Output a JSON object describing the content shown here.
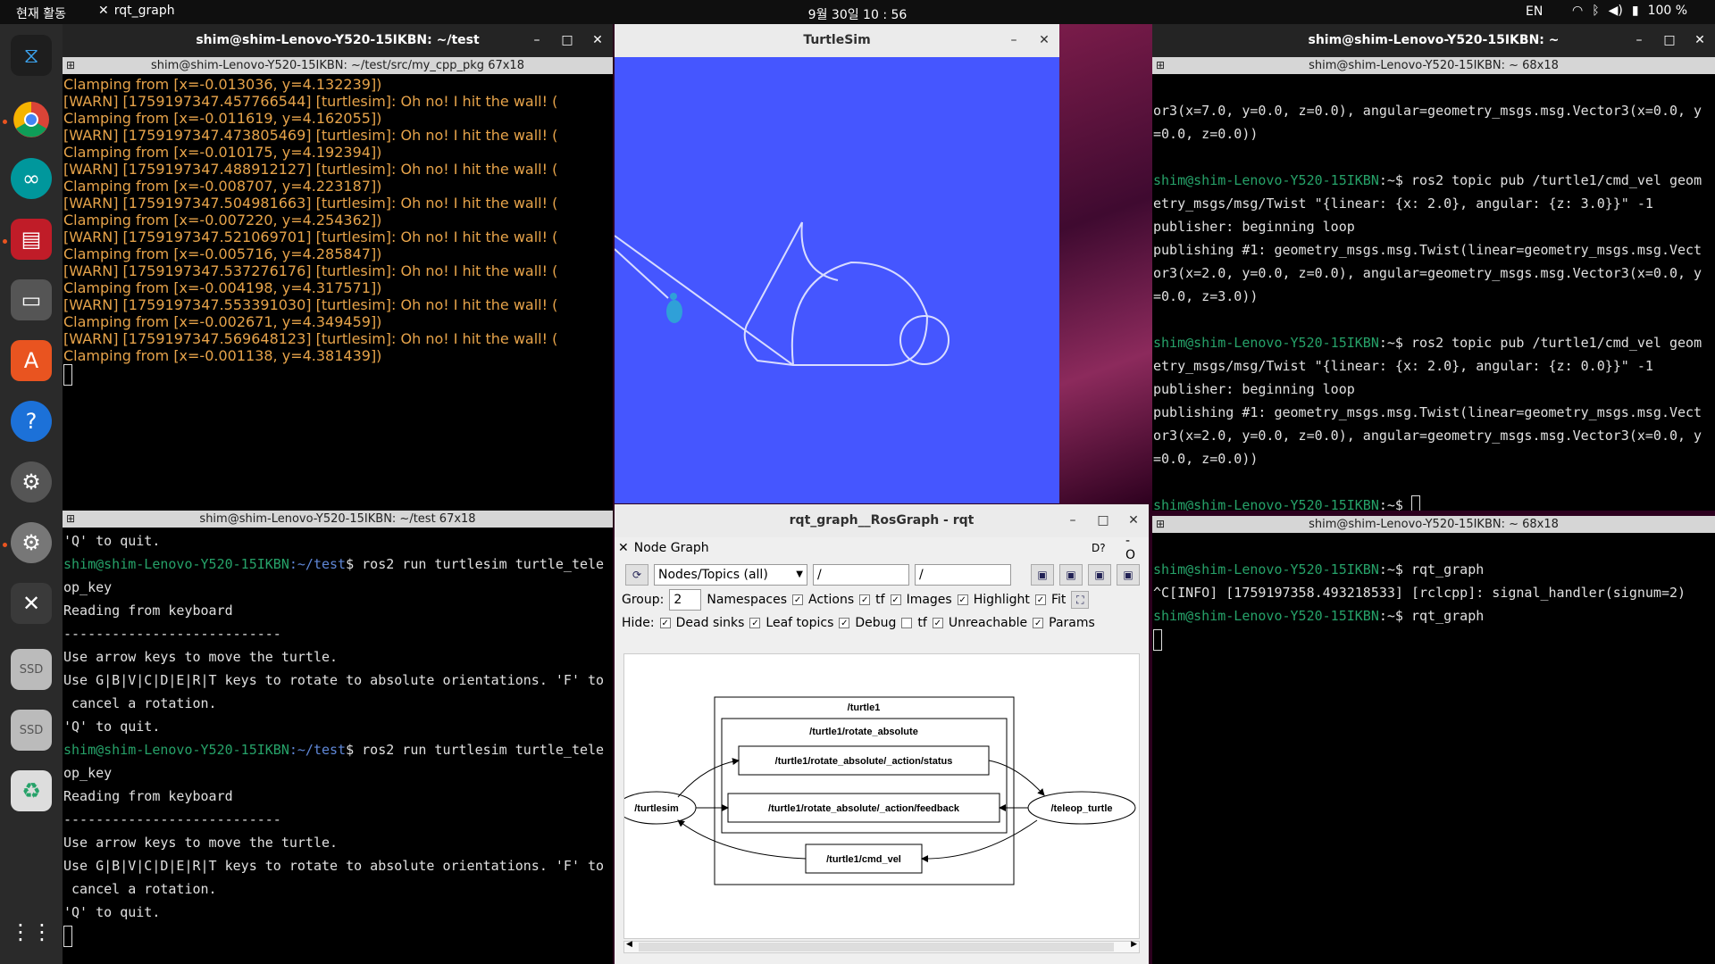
{
  "topbar": {
    "activities": "현재 활동",
    "app_name": "rqt_graph",
    "clock": "9월 30일  10 : 56",
    "lang": "EN",
    "battery": "100 %"
  },
  "windows": {
    "term_top_left": {
      "title": "shim@shim-Lenovo-Y520-15IKBN: ~/test",
      "tab": "shim@shim-Lenovo-Y520-15IKBN: ~/test/src/my_cpp_pkg 67x18",
      "lines": [
        {
          "t": "Clamping from [x=-0.013036, y=4.132239])",
          "c": "warn"
        },
        {
          "t": "[WARN] [1759197347.457766544] [turtlesim]: Oh no! I hit the wall! (",
          "c": "warn"
        },
        {
          "t": "Clamping from [x=-0.011619, y=4.162055])",
          "c": "warn"
        },
        {
          "t": "[WARN] [1759197347.473805469] [turtlesim]: Oh no! I hit the wall! (",
          "c": "warn"
        },
        {
          "t": "Clamping from [x=-0.010175, y=4.192394])",
          "c": "warn"
        },
        {
          "t": "[WARN] [1759197347.488912127] [turtlesim]: Oh no! I hit the wall! (",
          "c": "warn"
        },
        {
          "t": "Clamping from [x=-0.008707, y=4.223187])",
          "c": "warn"
        },
        {
          "t": "[WARN] [1759197347.504981663] [turtlesim]: Oh no! I hit the wall! (",
          "c": "warn"
        },
        {
          "t": "Clamping from [x=-0.007220, y=4.254362])",
          "c": "warn"
        },
        {
          "t": "[WARN] [1759197347.521069701] [turtlesim]: Oh no! I hit the wall! (",
          "c": "warn"
        },
        {
          "t": "Clamping from [x=-0.005716, y=4.285847])",
          "c": "warn"
        },
        {
          "t": "[WARN] [1759197347.537276176] [turtlesim]: Oh no! I hit the wall! (",
          "c": "warn"
        },
        {
          "t": "Clamping from [x=-0.004198, y=4.317571])",
          "c": "warn"
        },
        {
          "t": "[WARN] [1759197347.553391030] [turtlesim]: Oh no! I hit the wall! (",
          "c": "warn"
        },
        {
          "t": "Clamping from [x=-0.002671, y=4.349459])",
          "c": "warn"
        },
        {
          "t": "[WARN] [1759197347.569648123] [turtlesim]: Oh no! I hit the wall! (",
          "c": "warn"
        },
        {
          "t": "Clamping from [x=-0.001138, y=4.381439])",
          "c": "warn"
        }
      ]
    },
    "term_bottom_left": {
      "tab": "shim@shim-Lenovo-Y520-15IKBN: ~/test 67x18",
      "prompt_user": "shim@shim-Lenovo-Y520-15IKBN",
      "prompt_dir": ":~/test",
      "lines_a": [
        "'Q' to quit."
      ],
      "cmd1": "$ ros2 run turtlesim turtle_tele",
      "lines_b": [
        "op_key",
        "Reading from keyboard",
        "---------------------------",
        "Use arrow keys to move the turtle.",
        "Use G|B|V|C|D|E|R|T keys to rotate to absolute orientations. 'F' to",
        " cancel a rotation.",
        "'Q' to quit."
      ],
      "cmd2": "$ ros2 run turtlesim turtle_tele",
      "lines_c": [
        "op_key",
        "Reading from keyboard",
        "---------------------------",
        "Use arrow keys to move the turtle.",
        "Use G|B|V|C|D|E|R|T keys to rotate to absolute orientations. 'F' to",
        " cancel a rotation.",
        "'Q' to quit."
      ]
    },
    "turtlesim": {
      "title": "TurtleSim"
    },
    "rqt": {
      "title": "rqt_graph__RosGraph - rqt",
      "plugin": "Node Graph",
      "dropdown": "Nodes/Topics (all)",
      "filter1": "/",
      "filter2": "/",
      "group_label": "Group:",
      "group_value": "2",
      "namespaces": "Namespaces",
      "actions": "Actions",
      "tf": "tf",
      "images": "Images",
      "highlight": "Highlight",
      "fit": "Fit",
      "hide_label": "Hide:",
      "dead_sinks": "Dead sinks",
      "leaf_topics": "Leaf topics",
      "debug": "Debug",
      "tf2": "tf",
      "unreachable": "Unreachable",
      "params": "Params",
      "graph": {
        "ns_turtle1": "/turtle1",
        "ns_rotate": "/turtle1/rotate_absolute",
        "status": "/turtle1/rotate_absolute/_action/status",
        "feedback": "/turtle1/rotate_absolute/_action/feedback",
        "cmd_vel": "/turtle1/cmd_vel",
        "turtlesim": "/turtlesim",
        "teleop": "/teleop_turtle"
      }
    },
    "term_top_right": {
      "title": "shim@shim-Lenovo-Y520-15IKBN: ~",
      "tab": "shim@shim-Lenovo-Y520-15IKBN: ~ 68x18",
      "prompt": "shim@shim-Lenovo-Y520-15IKBN",
      "l1": "or3(x=7.0, y=0.0, z=0.0), angular=geometry_msgs.msg.Vector3(x=0.0, y",
      "l2": "=0.0, z=0.0))",
      "c1a": ":~$ ros2 topic pub /turtle1/cmd_vel geom",
      "c1b": "etry_msgs/msg/Twist \"{linear: {x: 2.0}, angular: {z: 3.0}}\" -1",
      "p1": "publisher: beginning loop",
      "p2": "publishing #1: geometry_msgs.msg.Twist(linear=geometry_msgs.msg.Vect",
      "p3": "or3(x=2.0, y=0.0, z=0.0), angular=geometry_msgs.msg.Vector3(x=0.0, y",
      "p4": "=0.0, z=3.0))",
      "c2a": ":~$ ros2 topic pub /turtle1/cmd_vel geom",
      "c2b": "etry_msgs/msg/Twist \"{linear: {x: 2.0}, angular: {z: 0.0}}\" -1",
      "q1": "publisher: beginning loop",
      "q2": "publishing #1: geometry_msgs.msg.Twist(linear=geometry_msgs.msg.Vect",
      "q3": "or3(x=2.0, y=0.0, z=0.0), angular=geometry_msgs.msg.Vector3(x=0.0, y",
      "q4": "=0.0, z=0.0))",
      "end": ":~$ "
    },
    "term_bottom_right": {
      "tab": "shim@shim-Lenovo-Y520-15IKBN: ~ 68x18",
      "prompt": "shim@shim-Lenovo-Y520-15IKBN",
      "c1": ":~$ rqt_graph",
      "l1": "^C[INFO] [1759197358.493218533] [rclcpp]: signal_handler(signum=2)",
      "c2": ":~$ rqt_graph"
    }
  },
  "colors": {
    "warn": "#e6a34a",
    "prompt": "#26a269",
    "dir": "#5f87d7",
    "turtlesim_bg": "#4556ff"
  }
}
